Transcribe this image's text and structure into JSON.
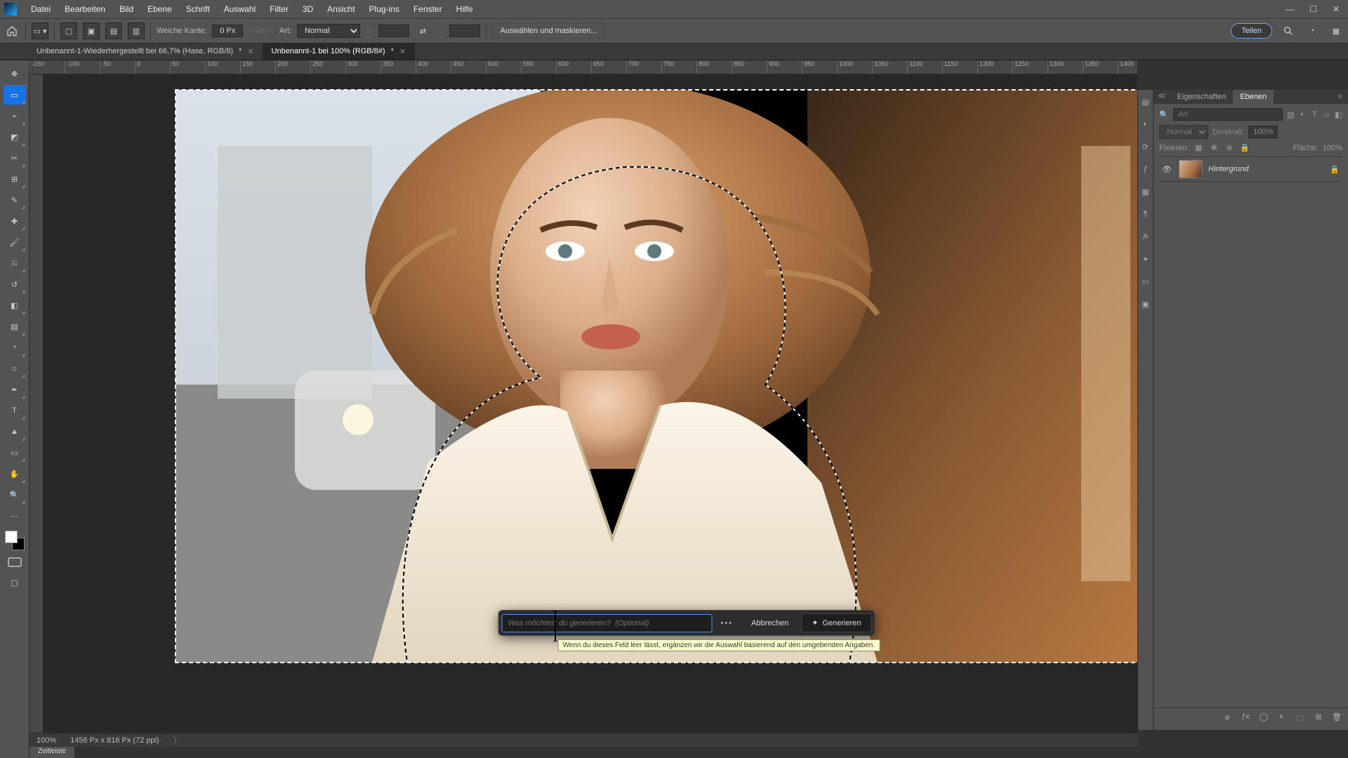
{
  "menu": {
    "items": [
      "Datei",
      "Bearbeiten",
      "Bild",
      "Ebene",
      "Schrift",
      "Auswahl",
      "Filter",
      "3D",
      "Ansicht",
      "Plug-ins",
      "Fenster",
      "Hilfe"
    ]
  },
  "options": {
    "feather_label": "Weiche Kante:",
    "feather_value": "0 Px",
    "antialias_label": "Glätten",
    "style_label": "Art:",
    "style_value": "Normal",
    "width_label": "B:",
    "height_label": "H:",
    "select_mask": "Auswählen und maskieren...",
    "share": "Teilen"
  },
  "tabs": [
    {
      "title": "Unbenannt-1-Wiederhergestellt bei 66,7% (Hase, RGB/8)",
      "dirty": "*"
    },
    {
      "title": "Unbenannt-1 bei 100% (RGB/8#)",
      "dirty": "*"
    }
  ],
  "ruler": {
    "start": -150,
    "step": 50,
    "count": 34
  },
  "gen": {
    "placeholder": "Was möchtest du generieren?  (Optional)",
    "cancel": "Abbrechen",
    "generate": "Generieren",
    "tooltip": "Wenn du dieses Feld leer lässt, ergänzen wir die Auswahl basierend auf den umgebenden Angaben."
  },
  "status": {
    "zoom": "100%",
    "info": "1456 Px x 816 Px (72 ppi)"
  },
  "timeline": "Zeitleiste",
  "panels": {
    "tabs": [
      "Eigenschaften",
      "Ebenen"
    ],
    "search_placeholder": "Art",
    "blend_mode": "Normal",
    "opacity_label": "Deckkraft:",
    "opacity": "100%",
    "fixieren_label": "Fixieren:",
    "fill_label": "Fläche:",
    "fill": "100%",
    "layer_name": "Hintergrund"
  }
}
